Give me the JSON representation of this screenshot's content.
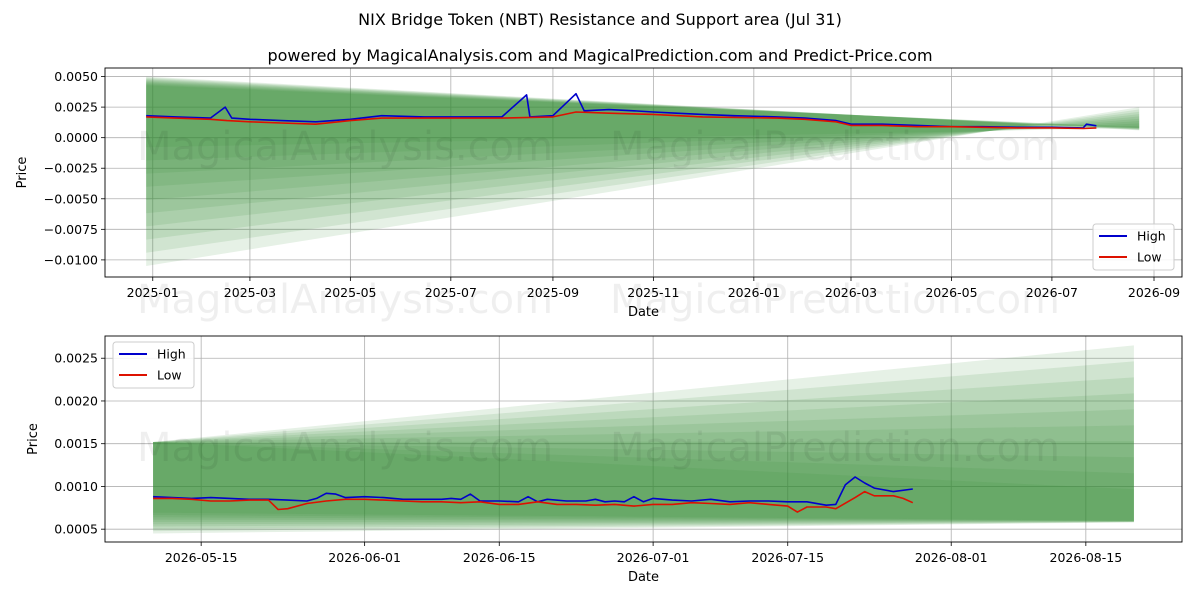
{
  "title": "NIX Bridge Token (NBT) Resistance and Support area (Jul 31)",
  "subtitle": "powered by MagicalAnalysis.com and MagicalPrediction.com and Predict-Price.com",
  "watermarks": [
    "MagicalAnalysis.com",
    "MagicalPrediction.com"
  ],
  "colors": {
    "high": "#0000cc",
    "low": "#dd1100",
    "band": "#2e8b2e",
    "grid": "#b0b0b0"
  },
  "chart_data": [
    {
      "type": "line",
      "xlabel": "Date",
      "ylabel": "Price",
      "xlim": [
        "2024-12-03",
        "2026-09-18"
      ],
      "ylim": [
        -0.0114,
        0.0057
      ],
      "xticks": [
        "2025-01",
        "2025-03",
        "2025-05",
        "2025-07",
        "2025-09",
        "2025-11",
        "2026-01",
        "2026-03",
        "2026-05",
        "2026-07",
        "2026-09"
      ],
      "yticks": [
        "0.0050",
        "0.0025",
        "0.0000",
        "−0.0025",
        "−0.0050",
        "−0.0075",
        "−0.0100"
      ],
      "grid": true,
      "legend_position": "lower-right",
      "band": {
        "start": "2024-12-28",
        "end": "2026-08-23",
        "upper_start": 0.005,
        "upper_end": 0.0006,
        "lower_start": -0.0105,
        "lower_end": 0.0025,
        "dense_upper_start": 0.0042,
        "dense_upper_end": 0.0009,
        "dense_lower_start": 0.0003,
        "dense_lower_end": 0.0006
      },
      "series": [
        {
          "name": "High",
          "x": [
            "2024-12-28",
            "2025-01-15",
            "2025-02-05",
            "2025-02-14",
            "2025-02-18",
            "2025-03-01",
            "2025-03-20",
            "2025-04-10",
            "2025-05-01",
            "2025-05-20",
            "2025-06-15",
            "2025-07-05",
            "2025-08-01",
            "2025-08-16",
            "2025-08-18",
            "2025-09-01",
            "2025-09-15",
            "2025-09-20",
            "2025-10-05",
            "2025-10-20",
            "2025-11-01",
            "2025-11-15",
            "2025-12-01",
            "2025-12-20",
            "2026-01-15",
            "2026-02-01",
            "2026-02-20",
            "2026-03-01",
            "2026-03-20",
            "2026-04-10",
            "2026-05-01",
            "2026-05-20",
            "2026-06-10",
            "2026-07-01",
            "2026-07-20",
            "2026-07-22",
            "2026-07-28"
          ],
          "y": [
            0.0018,
            0.0017,
            0.0016,
            0.0025,
            0.0016,
            0.0015,
            0.0014,
            0.0013,
            0.0015,
            0.0018,
            0.0017,
            0.0017,
            0.0017,
            0.0035,
            0.0017,
            0.0018,
            0.0036,
            0.0022,
            0.0023,
            0.0022,
            0.0021,
            0.002,
            0.0019,
            0.0018,
            0.0017,
            0.0016,
            0.0014,
            0.0011,
            0.0011,
            0.001,
            0.0009,
            0.0009,
            0.00085,
            0.00085,
            0.0008,
            0.0011,
            0.00097
          ]
        },
        {
          "name": "Low",
          "x": [
            "2024-12-28",
            "2025-01-15",
            "2025-02-05",
            "2025-02-15",
            "2025-03-01",
            "2025-03-20",
            "2025-04-10",
            "2025-05-01",
            "2025-05-20",
            "2025-06-15",
            "2025-07-05",
            "2025-08-01",
            "2025-09-01",
            "2025-09-15",
            "2025-10-05",
            "2025-11-01",
            "2025-12-01",
            "2026-01-15",
            "2026-02-01",
            "2026-02-20",
            "2026-03-01",
            "2026-03-20",
            "2026-04-10",
            "2026-05-01",
            "2026-05-20",
            "2026-06-10",
            "2026-07-01",
            "2026-07-20",
            "2026-07-28"
          ],
          "y": [
            0.0017,
            0.0016,
            0.0015,
            0.0014,
            0.0013,
            0.0012,
            0.0011,
            0.0014,
            0.0016,
            0.0016,
            0.0016,
            0.0016,
            0.0017,
            0.0021,
            0.002,
            0.0019,
            0.0017,
            0.0016,
            0.0015,
            0.0013,
            0.001,
            0.001,
            0.0009,
            0.0009,
            0.00085,
            0.0008,
            0.0008,
            0.00075,
            0.0008
          ]
        }
      ]
    },
    {
      "type": "line",
      "xlabel": "Date",
      "ylabel": "Price",
      "xlim": [
        "2026-05-05",
        "2026-08-25"
      ],
      "ylim": [
        0.00035,
        0.00276
      ],
      "xticks": [
        "2026-05-15",
        "2026-06-01",
        "2026-06-15",
        "2026-07-01",
        "2026-07-15",
        "2026-08-01",
        "2026-08-15"
      ],
      "yticks": [
        "0.0025",
        "0.0020",
        "0.0015",
        "0.0010",
        "0.0005"
      ],
      "grid": true,
      "legend_position": "upper-left",
      "band": {
        "start": "2026-05-10",
        "end": "2026-08-20",
        "upper_start": 0.00152,
        "upper_end": 0.00265,
        "lower_start": 0.00045,
        "lower_end": 0.00058,
        "dense_upper_start": 0.00152,
        "dense_upper_end": 0.00078,
        "dense_lower_start": 0.00072,
        "dense_lower_end": 0.0006
      },
      "series": [
        {
          "name": "High",
          "x": [
            "2026-05-10",
            "2026-05-12",
            "2026-05-14",
            "2026-05-16",
            "2026-05-18",
            "2026-05-20",
            "2026-05-22",
            "2026-05-24",
            "2026-05-26",
            "2026-05-27",
            "2026-05-28",
            "2026-05-29",
            "2026-05-30",
            "2026-06-01",
            "2026-06-03",
            "2026-06-05",
            "2026-06-07",
            "2026-06-09",
            "2026-06-10",
            "2026-06-11",
            "2026-06-12",
            "2026-06-13",
            "2026-06-15",
            "2026-06-17",
            "2026-06-18",
            "2026-06-19",
            "2026-06-20",
            "2026-06-22",
            "2026-06-24",
            "2026-06-25",
            "2026-06-26",
            "2026-06-27",
            "2026-06-28",
            "2026-06-29",
            "2026-06-30",
            "2026-07-01",
            "2026-07-03",
            "2026-07-05",
            "2026-07-07",
            "2026-07-09",
            "2026-07-11",
            "2026-07-13",
            "2026-07-15",
            "2026-07-17",
            "2026-07-19",
            "2026-07-20",
            "2026-07-21",
            "2026-07-22",
            "2026-07-23",
            "2026-07-24",
            "2026-07-26",
            "2026-07-28"
          ],
          "y": [
            0.00088,
            0.00087,
            0.00086,
            0.00087,
            0.00086,
            0.00085,
            0.00085,
            0.00084,
            0.00083,
            0.00086,
            0.00092,
            0.00091,
            0.00087,
            0.00088,
            0.00087,
            0.00085,
            0.00085,
            0.00085,
            0.00086,
            0.00085,
            0.00091,
            0.00083,
            0.00083,
            0.00082,
            0.00088,
            0.00082,
            0.00085,
            0.00083,
            0.00083,
            0.00085,
            0.00082,
            0.00083,
            0.00082,
            0.00088,
            0.00082,
            0.00086,
            0.00084,
            0.00083,
            0.00085,
            0.00082,
            0.00083,
            0.00083,
            0.00082,
            0.00082,
            0.00078,
            0.00079,
            0.00102,
            0.00111,
            0.00104,
            0.00098,
            0.00094,
            0.00097
          ]
        },
        {
          "name": "Low",
          "x": [
            "2026-05-10",
            "2026-05-12",
            "2026-05-14",
            "2026-05-16",
            "2026-05-18",
            "2026-05-20",
            "2026-05-22",
            "2026-05-23",
            "2026-05-24",
            "2026-05-26",
            "2026-05-28",
            "2026-05-30",
            "2026-06-01",
            "2026-06-03",
            "2026-06-05",
            "2026-06-07",
            "2026-06-09",
            "2026-06-11",
            "2026-06-13",
            "2026-06-15",
            "2026-06-17",
            "2026-06-19",
            "2026-06-21",
            "2026-06-23",
            "2026-06-25",
            "2026-06-27",
            "2026-06-29",
            "2026-07-01",
            "2026-07-03",
            "2026-07-05",
            "2026-07-07",
            "2026-07-09",
            "2026-07-11",
            "2026-07-13",
            "2026-07-15",
            "2026-07-16",
            "2026-07-17",
            "2026-07-19",
            "2026-07-20",
            "2026-07-22",
            "2026-07-23",
            "2026-07-24",
            "2026-07-26",
            "2026-07-27",
            "2026-07-28"
          ],
          "y": [
            0.00086,
            0.00086,
            0.00085,
            0.00083,
            0.00083,
            0.00084,
            0.00084,
            0.00073,
            0.00074,
            0.0008,
            0.00083,
            0.00085,
            0.00085,
            0.00084,
            0.00083,
            0.00082,
            0.00082,
            0.00081,
            0.00082,
            0.00079,
            0.00079,
            0.00082,
            0.00079,
            0.00079,
            0.00078,
            0.00079,
            0.00077,
            0.00079,
            0.00079,
            0.00081,
            0.0008,
            0.00079,
            0.00081,
            0.00079,
            0.00077,
            0.0007,
            0.00076,
            0.00076,
            0.00074,
            0.00087,
            0.00094,
            0.00089,
            0.00089,
            0.00086,
            0.00081
          ]
        }
      ]
    }
  ]
}
